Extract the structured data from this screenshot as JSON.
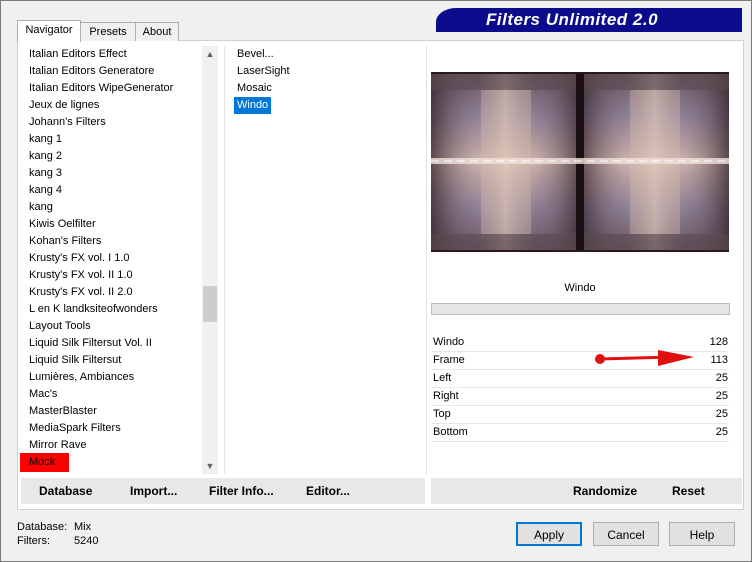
{
  "app": {
    "title": "Filters Unlimited 2.0"
  },
  "tabs": [
    {
      "label": "Navigator",
      "active": true
    },
    {
      "label": "Presets",
      "active": false
    },
    {
      "label": "About",
      "active": false
    }
  ],
  "categories": {
    "items": [
      "Italian Editors Effect",
      "Italian Editors Generatore",
      "Italian Editors WipeGenerator",
      "Jeux de lignes",
      "Johann's Filters",
      "kang 1",
      "kang 2",
      "kang 3",
      "kang 4",
      "kang",
      "Kiwis Oelfilter",
      "Kohan's Filters",
      "Krusty's FX vol. I 1.0",
      "Krusty's FX vol. II 1.0",
      "Krusty's FX vol. II 2.0",
      "L en K landksiteofwonders",
      "Layout Tools",
      "Liquid Silk Filtersut Vol. II",
      "Liquid Silk Filtersut",
      "Lumières, Ambiances",
      "Mac's",
      "MasterBlaster",
      "MediaSpark Filters",
      "Mirror Rave",
      "Mock"
    ],
    "selected": "Mock"
  },
  "filters": {
    "items": [
      "Bevel...",
      "LaserSight",
      "Mosaic",
      "Windo"
    ],
    "selected": "Windo"
  },
  "preview": {
    "filter_name": "Windo"
  },
  "params": [
    {
      "label": "Windo",
      "value": "128"
    },
    {
      "label": "Frame",
      "value": "113"
    },
    {
      "label": "Left",
      "value": "25"
    },
    {
      "label": "Right",
      "value": "25"
    },
    {
      "label": "Top",
      "value": "25"
    },
    {
      "label": "Bottom",
      "value": "25"
    }
  ],
  "toolbar_left": {
    "database": "Database",
    "import": "Import...",
    "filter_info": "Filter Info...",
    "editor": "Editor..."
  },
  "toolbar_right": {
    "randomize": "Randomize",
    "reset": "Reset"
  },
  "status": {
    "database_label": "Database:",
    "database_value": "Mix",
    "filters_label": "Filters:",
    "filters_value": "5240"
  },
  "buttons": {
    "apply": "Apply",
    "cancel": "Cancel",
    "help": "Help"
  },
  "colors": {
    "banner": "#0b0b8c",
    "selection": "#0078d7",
    "highlight_red": "#ff0000",
    "annotation_arrow": "#e01010"
  },
  "icons": {
    "scroll_up": "chevron-up-icon",
    "scroll_down": "chevron-down-icon",
    "annotation": "red-arrow-icon"
  }
}
